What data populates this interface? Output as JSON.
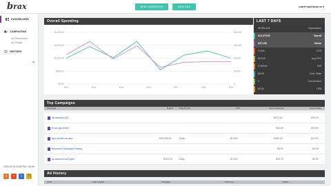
{
  "header": {
    "logo_mark": "b",
    "logo_text": "rax",
    "new_campaign_label": "NEW CAMPAIGNS",
    "new_ad_label": "NEW ADS",
    "user_email": "mark+qa@brax.io ▾"
  },
  "sidebar": {
    "dashboard_label": "DASHBOARD",
    "campaigns_label": "CAMPAIGNS",
    "sub_items": [
      "Ad Performance",
      "Ad Groups"
    ],
    "history_label": "HISTORY",
    "collapse_glyph": "«",
    "datetime": "2016-09-20 03:58 PM - Devbt",
    "platforms": [
      "T",
      "T",
      "Y",
      "▲"
    ],
    "sort_glyph": "⇅"
  },
  "overall_spending": {
    "title": "Overall Spending",
    "chart_data": {
      "type": "line",
      "x": [
        "9/12",
        "9/14",
        "9/15",
        "9/16",
        "9/17",
        "9/18",
        "9/19"
      ],
      "left_ticks": [
        "$2,000.00",
        "$1,500.00",
        "$1,000.00",
        "$500.00",
        "$0.00"
      ],
      "right_ticks": [
        "160,000",
        "120,000",
        "80,000",
        "40,000",
        "0"
      ],
      "ylim_left": [
        0,
        2000
      ],
      "ylim_right": [
        0,
        160000
      ],
      "series": [
        {
          "values": [
            1000,
            1450,
            1020,
            1650,
            550,
            1120,
            1280,
            1000
          ],
          "color": "#4fb8a6"
        },
        {
          "values": [
            1130,
            1650,
            970,
            1480,
            650,
            840,
            870,
            870
          ],
          "color": "#c78fcd"
        }
      ]
    }
  },
  "last7": {
    "title": "LAST 7 DAYS",
    "rows": [
      {
        "value": "36,952,104",
        "label": "Impressions",
        "color": "#3a3a3a",
        "highlight": false
      },
      {
        "value": "$13,479.90",
        "label": "Spend",
        "color": "#41c3ae",
        "highlight": true
      },
      {
        "value": "537,158",
        "label": "Clicks",
        "color": "#a44dbb",
        "highlight": true
      },
      {
        "value": "0.15%",
        "label": "CTR",
        "color": "#e05a3a",
        "highlight": false
      },
      {
        "value": "$0.025",
        "label": "Avg CPC",
        "color": "#c7b42c",
        "highlight": false
      },
      {
        "value": "0.0000%",
        "label": "ICR",
        "color": "#e0813a",
        "highlight": false
      },
      {
        "value": "$0.00",
        "label": "Conv. Rate",
        "color": "#45a0d6",
        "highlight": false
      },
      {
        "value": "0",
        "label": "Conversions",
        "color": "#7bbf4b",
        "highlight": false
      },
      {
        "value": "$0.00",
        "label": "CPA",
        "color": "#d69b3a",
        "highlight": false
      }
    ]
  },
  "top_campaigns": {
    "title": "Top Campaigns",
    "headers": [
      "Campaign",
      "Budget",
      "Budget Type",
      "CPC",
      "Spend Yesterday",
      "Spend Today"
    ],
    "rows": [
      {
        "name": "ab-stcdcua-4&2",
        "budget": "-",
        "budget_type": "-",
        "cpc": "-",
        "yesterday": "$472.80",
        "today": "$40.04"
      },
      {
        "name": "B rdc-pgs-Z05Q",
        "budget": "-",
        "budget_type": "-",
        "cpc": "-",
        "yesterday": "$18.90",
        "today": "$23.50"
      },
      {
        "name": "app-mobile-ua-lana",
        "budget": "$20,000.00",
        "budget_type": "Daily",
        "cpc": "$0.020",
        "yesterday": "$181.20",
        "today": "$10.63"
      },
      {
        "name": "Womama Campaign Testing",
        "budget": "-",
        "budget_type": "-",
        "cpc": "-",
        "yesterday": "$8.95",
        "today": "$4.96"
      },
      {
        "name": "ac-stcdcua-ua21gtrrn",
        "budget": "$100.00",
        "budget_type": "Daily",
        "cpc": "$0.020",
        "yesterday": "$34.75",
        "today": "$3.90"
      }
    ]
  },
  "ad_history": {
    "title": "Ad History",
    "headers": [
      "Ad ID",
      "Date Created",
      "Campaign",
      "Ad Group",
      "Status"
    ]
  }
}
